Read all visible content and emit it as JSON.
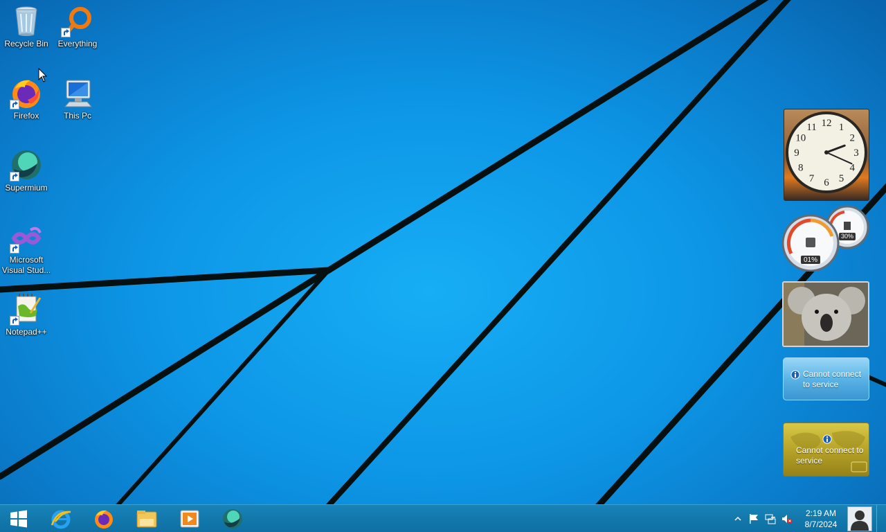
{
  "desktop": {
    "icons": [
      {
        "label": "Recycle Bin",
        "icon": "recycle-bin-icon"
      },
      {
        "label": "Everything",
        "icon": "everything-search-icon"
      },
      {
        "label": "Firefox",
        "icon": "firefox-icon"
      },
      {
        "label": "This Pc",
        "icon": "computer-icon"
      },
      {
        "label": "Supermium",
        "icon": "supermium-icon"
      },
      {
        "label": "Microsoft Visual Stud...",
        "icon": "visual-studio-icon"
      },
      {
        "label": "Notepad++",
        "icon": "notepad-plus-plus-icon"
      }
    ]
  },
  "gadgets": {
    "clock": {
      "numerals": [
        "12",
        "1",
        "2",
        "3",
        "4",
        "5",
        "6",
        "7",
        "8",
        "9",
        "10",
        "11"
      ],
      "hour": 2,
      "minute": 19
    },
    "cpu_meter": {
      "cpu_percent": "01%",
      "memory_percent": "30%"
    },
    "weather": {
      "message": "Cannot connect to service"
    },
    "currency": {
      "message": "Cannot connect to service"
    }
  },
  "taskbar": {
    "pinned": [
      {
        "name": "Internet Explorer",
        "icon": "internet-explorer-icon"
      },
      {
        "name": "Firefox",
        "icon": "firefox-icon"
      },
      {
        "name": "File Explorer",
        "icon": "file-explorer-icon"
      },
      {
        "name": "Media Player",
        "icon": "media-player-icon"
      },
      {
        "name": "Supermium",
        "icon": "supermium-icon"
      }
    ],
    "tray": {
      "time": "2:19 AM",
      "date": "8/7/2024",
      "icons": [
        "show-hidden-icons-arrow",
        "action-center-flag-icon",
        "network-icon",
        "volume-muted-icon"
      ]
    }
  },
  "colors": {
    "wallpaper": "#0d96e6",
    "taskbar": "#1178ab",
    "lines": "#0a0f0f"
  }
}
